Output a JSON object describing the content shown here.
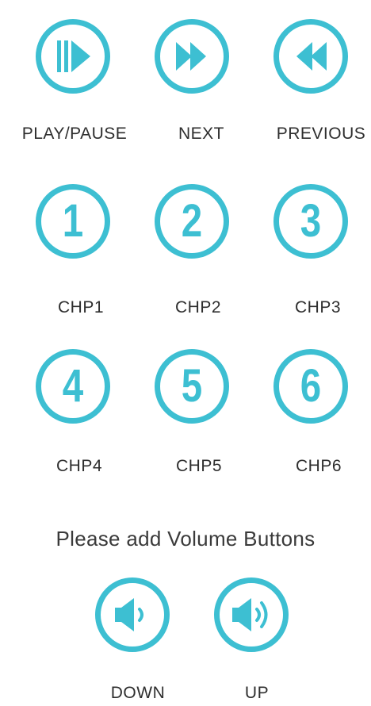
{
  "colors": {
    "accent": "#3dbfd2",
    "text": "#2e2e2e",
    "background": "#ffffff"
  },
  "transport": {
    "play_pause": {
      "label": "PLAY/PAUSE",
      "icon": "play-pause-icon"
    },
    "next": {
      "label": "NEXT",
      "icon": "fast-forward-icon"
    },
    "previous": {
      "label": "PREVIOUS",
      "icon": "rewind-icon"
    }
  },
  "chapters": [
    {
      "number": "1",
      "label": "CHP1"
    },
    {
      "number": "2",
      "label": "CHP2"
    },
    {
      "number": "3",
      "label": "CHP3"
    },
    {
      "number": "4",
      "label": "CHP4"
    },
    {
      "number": "5",
      "label": "CHP5"
    },
    {
      "number": "6",
      "label": "CHP6"
    }
  ],
  "volume_note": "Please add Volume Buttons",
  "volume": {
    "down": {
      "label": "DOWN",
      "icon": "volume-down-icon"
    },
    "up": {
      "label": "UP",
      "icon": "volume-up-icon"
    }
  }
}
